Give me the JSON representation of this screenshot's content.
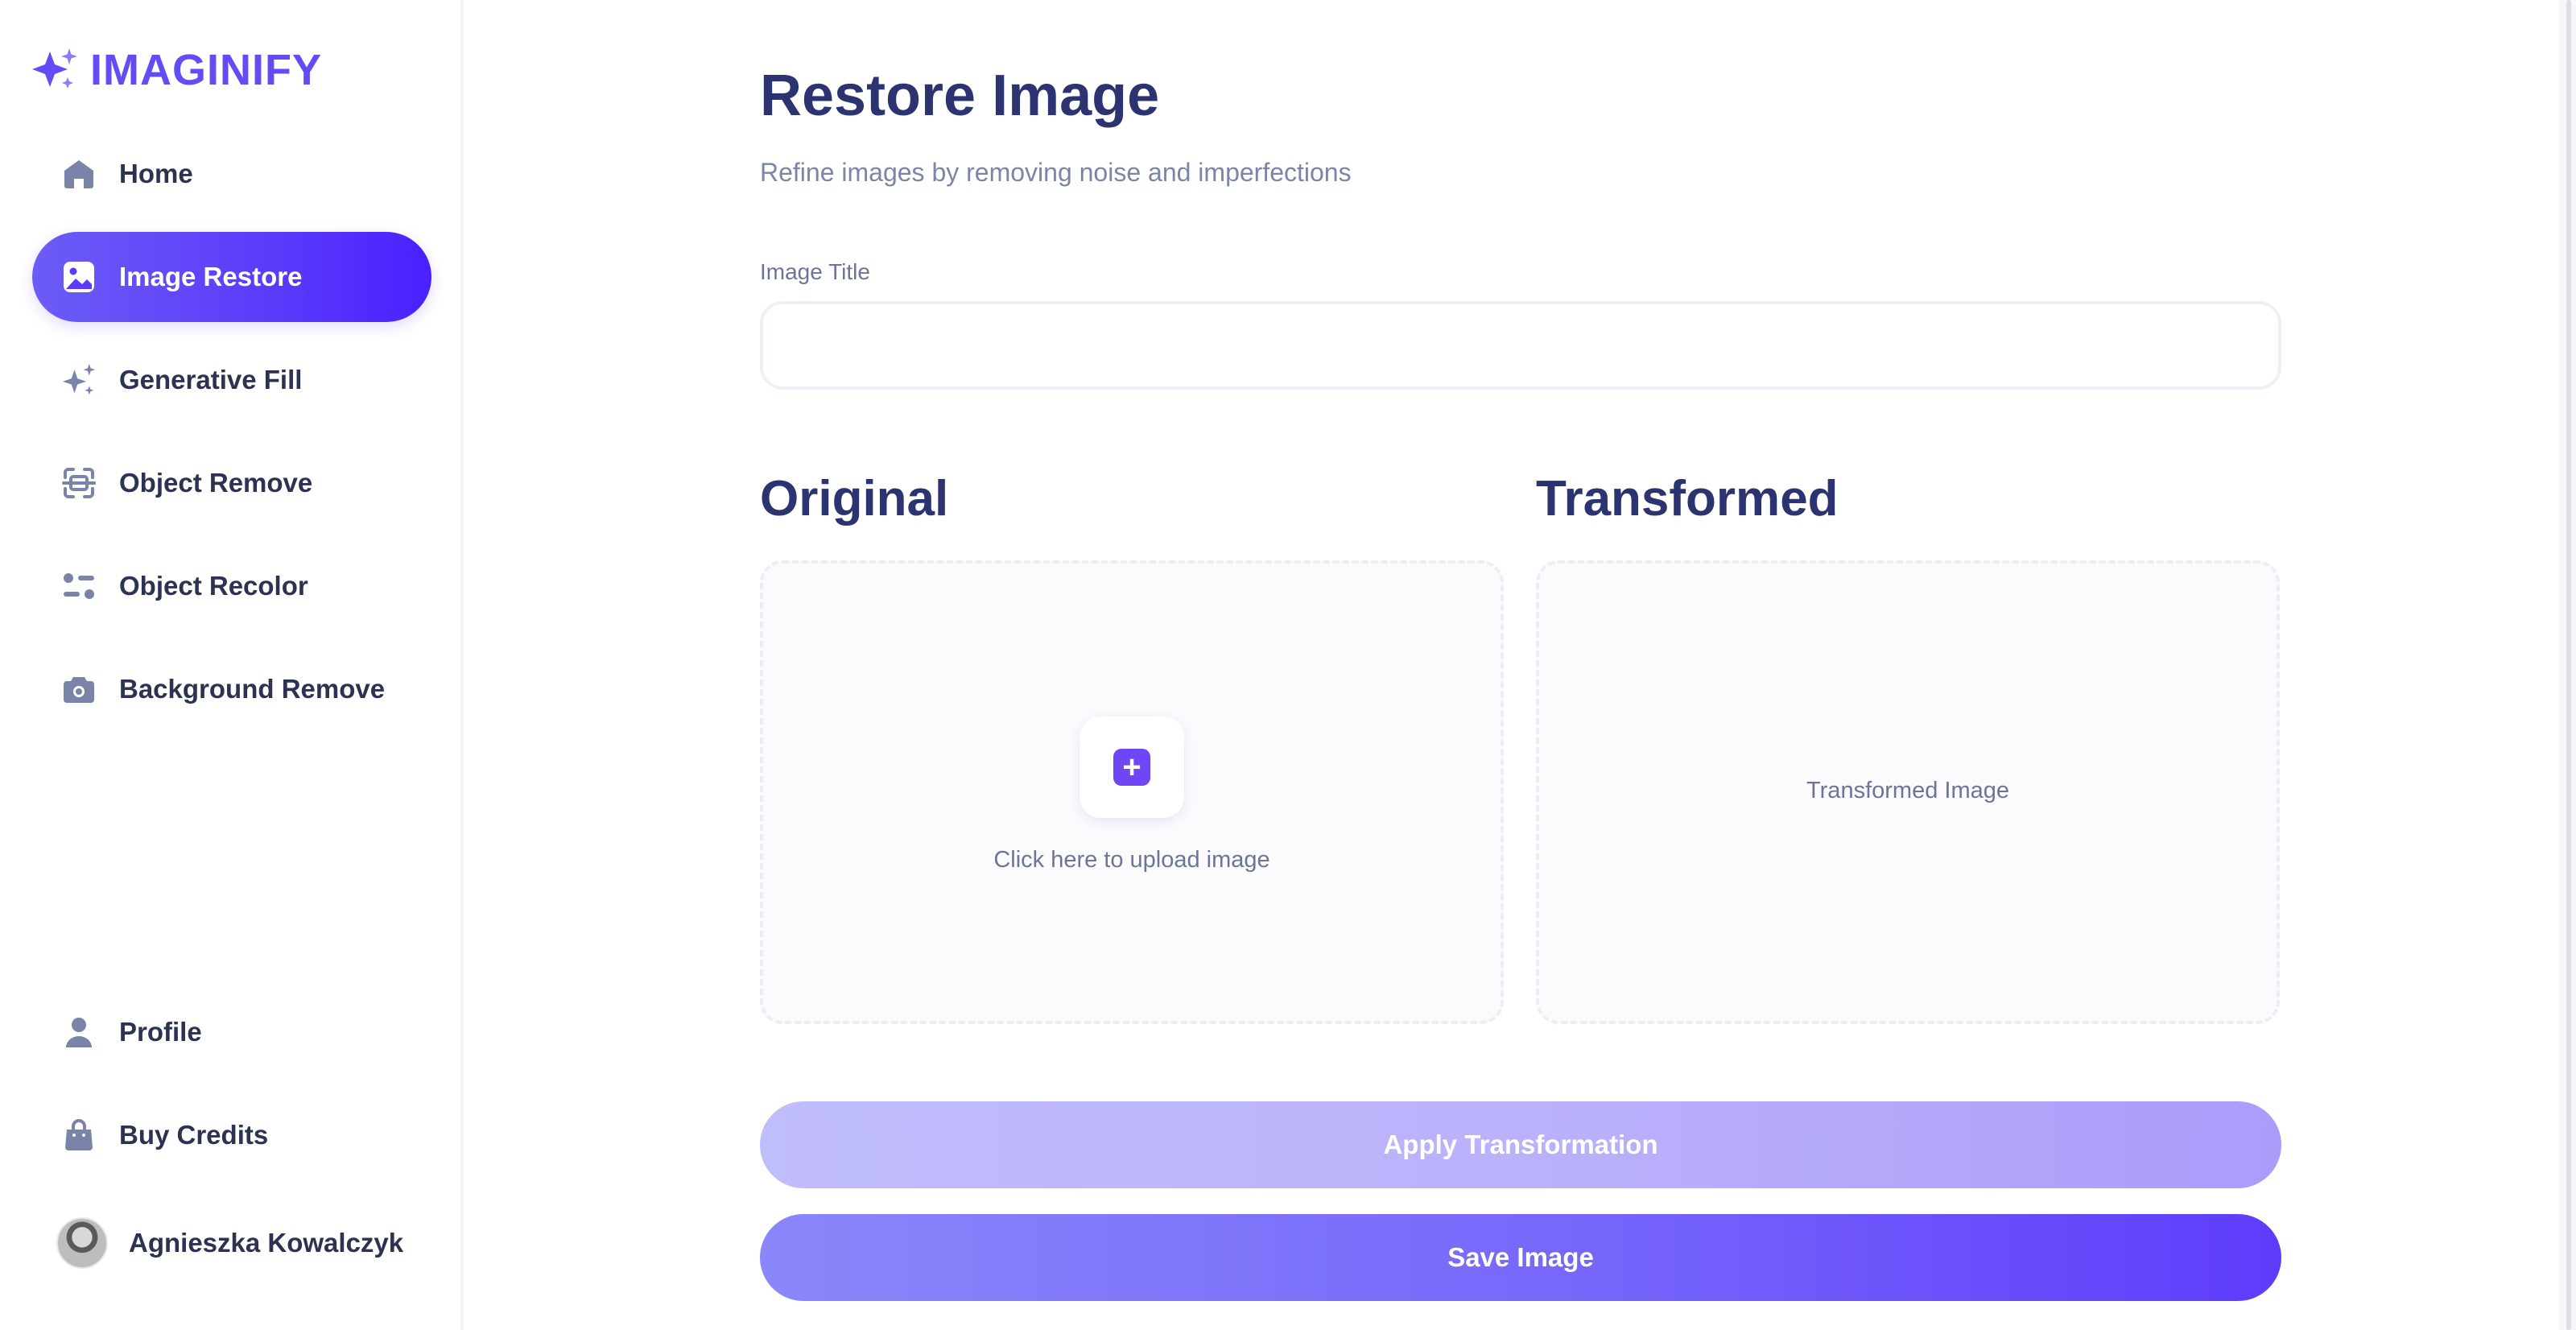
{
  "app": {
    "name": "IMAGINIFY",
    "logo_icon": "sparkles-icon",
    "accent": "#624cf5"
  },
  "sidebar": {
    "top_items": [
      {
        "label": "Home",
        "icon": "home-icon",
        "active": false
      },
      {
        "label": "Image Restore",
        "icon": "image-icon",
        "active": true
      },
      {
        "label": "Generative Fill",
        "icon": "stars-icon",
        "active": false
      },
      {
        "label": "Object Remove",
        "icon": "scan-icon",
        "active": false
      },
      {
        "label": "Object Recolor",
        "icon": "filter-icon",
        "active": false
      },
      {
        "label": "Background Remove",
        "icon": "camera-icon",
        "active": false
      }
    ],
    "bottom_items": [
      {
        "label": "Profile",
        "icon": "user-icon"
      },
      {
        "label": "Buy Credits",
        "icon": "bag-icon"
      }
    ],
    "user": {
      "name": "Agnieszka Kowalczyk"
    }
  },
  "main": {
    "title": "Restore Image",
    "subtitle": "Refine images by removing noise and imperfections",
    "field": {
      "label": "Image Title",
      "value": "",
      "placeholder": ""
    },
    "original": {
      "heading": "Original",
      "upload_text": "Click here to upload image",
      "upload_icon": "plus-icon"
    },
    "transformed": {
      "heading": "Transformed",
      "placeholder_text": "Transformed Image"
    },
    "buttons": {
      "apply": "Apply Transformation",
      "save": "Save Image"
    }
  }
}
